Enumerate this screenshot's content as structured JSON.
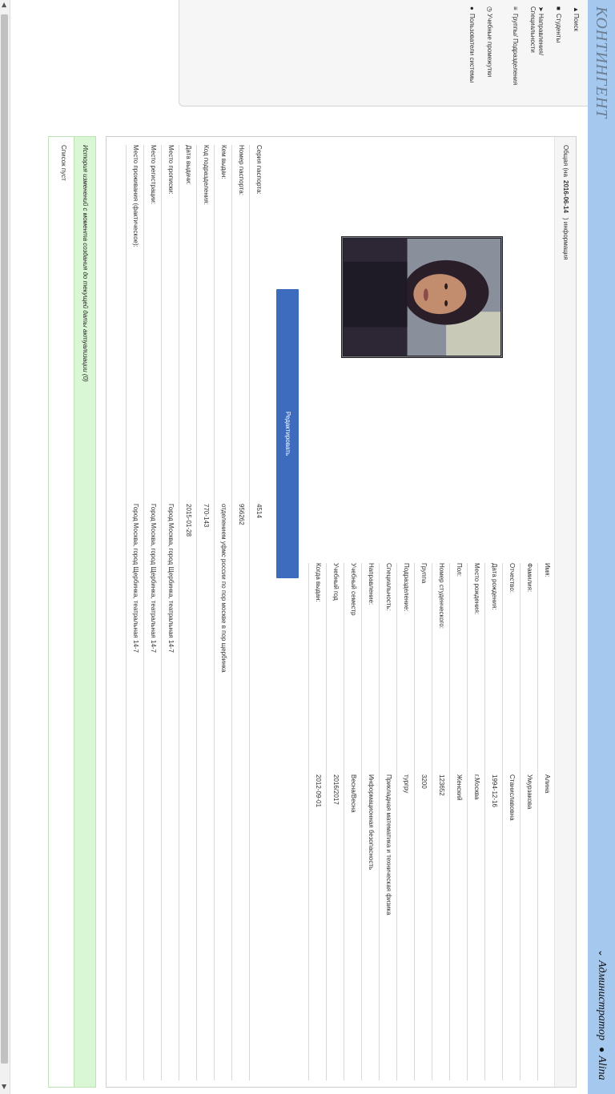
{
  "brand": "КОНТИНГЕНТ",
  "topbar": {
    "role_menu": "Администратор",
    "user_name": "Alina"
  },
  "sidebar": {
    "items": [
      {
        "label": "Поиск",
        "icon": "search-icon"
      },
      {
        "label": "Студенты",
        "icon": "students-icon"
      },
      {
        "label": "Направления/ Специальности",
        "icon": "arrow-icon"
      },
      {
        "label": "Группы/ Подразделения",
        "icon": "list-icon"
      },
      {
        "label": "Учебные промежутки",
        "icon": "clock-icon"
      },
      {
        "label": "Пользователи системы",
        "icon": "user-icon"
      }
    ]
  },
  "panel": {
    "heading_prefix": "Общая (на",
    "heading_date": "2016-06-14",
    "heading_suffix": ") информация",
    "edit_label": "Редактировать",
    "student_fields": [
      {
        "label": "Имя:",
        "value": "Алина"
      },
      {
        "label": "Фамилия:",
        "value": "Умурзакова"
      },
      {
        "label": "Отчество:",
        "value": "Станиславовна"
      },
      {
        "label": "Дата рождения:",
        "value": "1994-12-16"
      },
      {
        "label": "Место рождения:",
        "value": "г.Москва"
      },
      {
        "label": "Пол:",
        "value": "Женский"
      },
      {
        "label": "Номер студенческого:",
        "value": "123652"
      },
      {
        "label": "Группа",
        "value": "3200"
      },
      {
        "label": "Подразделение:",
        "value": "тургру"
      },
      {
        "label": "Специальность:",
        "value": "Прикладная математика и техническая физика"
      },
      {
        "label": "Направление:",
        "value": "Информационная безопасность"
      },
      {
        "label": "Учебный семестр",
        "value": "Весна/Весна"
      },
      {
        "label": "Учебный год",
        "value": "2016/2017"
      },
      {
        "label": "Когда выдан:",
        "value": "2012-09-01"
      }
    ],
    "passport_fields": [
      {
        "label": "Серия паспорта:",
        "value": "4514"
      },
      {
        "label": "Номер паспорта:",
        "value": "956262"
      },
      {
        "label": "Кем выдан:",
        "value": "отделением уфмс россии по пор москве в пор щербинка"
      },
      {
        "label": "Код подразделения:",
        "value": "770-143"
      },
      {
        "label": "Дата выдачи:",
        "value": "2015-01-28"
      },
      {
        "label": "Место прописки:",
        "value": "Город Москва, город Щербинка, театральная 14-7"
      },
      {
        "label": "Место регистрации:",
        "value": "Город Москва, город Щербинка, театральная 14-7"
      },
      {
        "label": "Место проживания (фактическое):",
        "value": "Город Москва, город Щербинка, театральная 14-7"
      }
    ]
  },
  "history": {
    "heading": "История изменений с момента создания до текущей даты актуализации (0)",
    "empty_text": "Список пуст"
  },
  "colors": {
    "topbar": "#a4c8ee",
    "edit_button": "#3d6bbd",
    "history_heading": "#d9f7d4"
  }
}
